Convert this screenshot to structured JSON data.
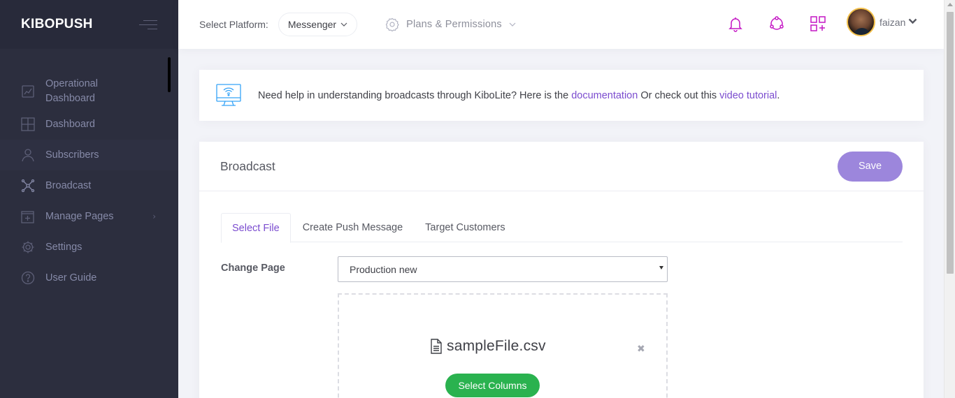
{
  "brand": "KIBOPUSH",
  "sidebar": {
    "items": [
      {
        "label": "Operational\nDashboard",
        "icon": "chart-icon"
      },
      {
        "label": "Dashboard",
        "icon": "grid-icon"
      },
      {
        "label": "Subscribers",
        "icon": "user-icon"
      },
      {
        "label": "Broadcast",
        "icon": "network-icon"
      },
      {
        "label": "Manage Pages",
        "icon": "add-square-icon"
      },
      {
        "label": "Settings",
        "icon": "gear-icon"
      },
      {
        "label": "User Guide",
        "icon": "help-icon"
      }
    ],
    "chevron": "›"
  },
  "header": {
    "platform_label": "Select Platform:",
    "platform_value": "Messenger",
    "plans_label": "Plans & Permissions",
    "username": "faizan",
    "accent_color": "#c417c4"
  },
  "banner": {
    "text_before": "Need help in understanding broadcasts through KiboLite? Here is the ",
    "doc_link": "documentation",
    "text_middle": " Or check out this ",
    "video_link": "video tutorial",
    "text_after": "."
  },
  "card": {
    "title": "Broadcast",
    "save_label": "Save",
    "tabs": [
      "Select File",
      "Create Push Message",
      "Target Customers"
    ],
    "change_page_label": "Change Page",
    "selected_page": "Production new",
    "file_name": "sampleFile.csv",
    "remove_symbol": "✖",
    "select_columns_label": "Select Columns"
  }
}
